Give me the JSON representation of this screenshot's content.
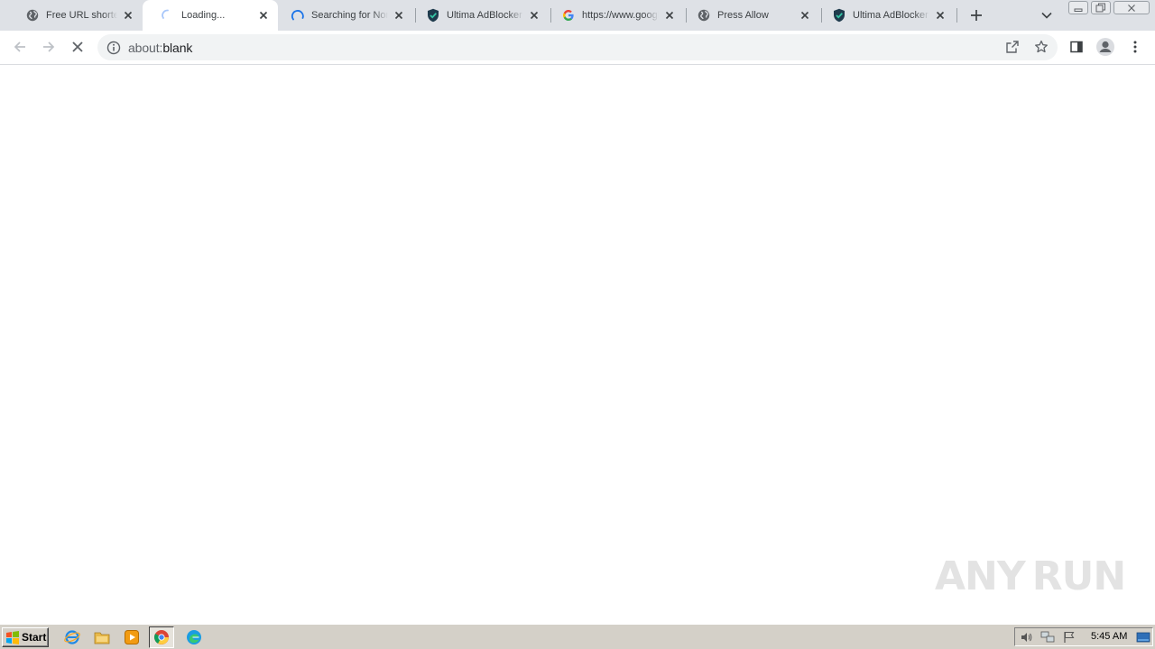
{
  "browser": {
    "tabs": [
      {
        "title": "Free URL shortener",
        "favicon": "globe-icon",
        "active": false
      },
      {
        "title": "Loading...",
        "favicon": "loading-spinner-icon",
        "active": true
      },
      {
        "title": "Searching for Normal",
        "favicon": "loading-spinner-icon",
        "active": false
      },
      {
        "title": "Ultima AdBlocker - ",
        "favicon": "shield-check-icon",
        "active": false
      },
      {
        "title": "https://www.google",
        "favicon": "google-g-icon",
        "active": false
      },
      {
        "title": "Press Allow",
        "favicon": "globe-icon",
        "active": false
      },
      {
        "title": "Ultima AdBlocker - ",
        "favicon": "shield-check-icon",
        "active": false
      }
    ],
    "address_bar": {
      "scheme": "about:",
      "rest": "blank"
    }
  },
  "watermark": {
    "left": "ANY",
    "right": "RUN"
  },
  "taskbar": {
    "start_label": "Start",
    "clock": "5:45 AM"
  },
  "colors": {
    "tabstrip": "#dee1e6",
    "omnibox": "#f1f3f4",
    "taskbar": "#d4d0c8",
    "google_blue": "#1a73e8"
  }
}
